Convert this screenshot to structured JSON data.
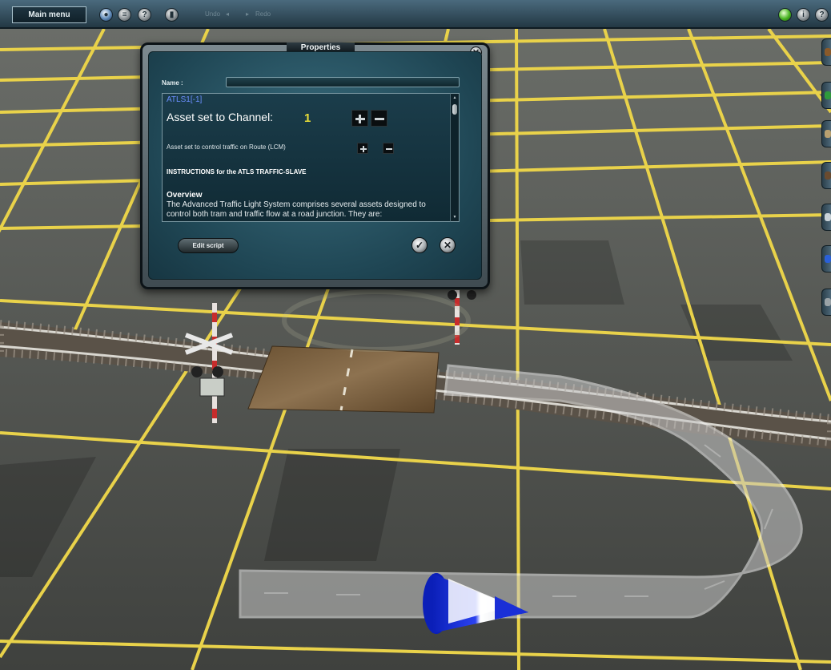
{
  "toolbar": {
    "main_menu_label": "Main menu",
    "undo_label": "Undo",
    "redo_label": "Redo"
  },
  "dialog": {
    "title": "Properties",
    "name_label": "Name :",
    "name_value": "",
    "asset_id": "ATLS1[-1]",
    "channel_label": "Asset set to Channel:",
    "channel_value": "1",
    "route_label": "Asset set to control traffic on Route (LCM)",
    "instructions_heading": "INSTRUCTIONS for the ATLS TRAFFIC-SLAVE",
    "overview_title": "Overview",
    "overview_text": "The Advanced Traffic Light System comprises several assets designed to control both tram and traffic flow at a road junction. They are:",
    "edit_script_label": "Edit script"
  },
  "colors": {
    "grid_line": "#e9d24a",
    "ground": "#4e504c",
    "accent_blue": "#1a2fd6"
  },
  "icons": {
    "toolbar_left": [
      "map-icon",
      "layers-icon",
      "help-icon",
      "trash-icon"
    ],
    "toolbar_right": [
      "status-green-icon",
      "info-icon",
      "help-icon"
    ],
    "side_tools": [
      "terrain-tool-icon",
      "paint-tool-icon",
      "object-tool-icon",
      "track-tool-icon",
      "train-tool-icon",
      "trackmark-tool-icon",
      "interlock-tool-icon"
    ]
  }
}
